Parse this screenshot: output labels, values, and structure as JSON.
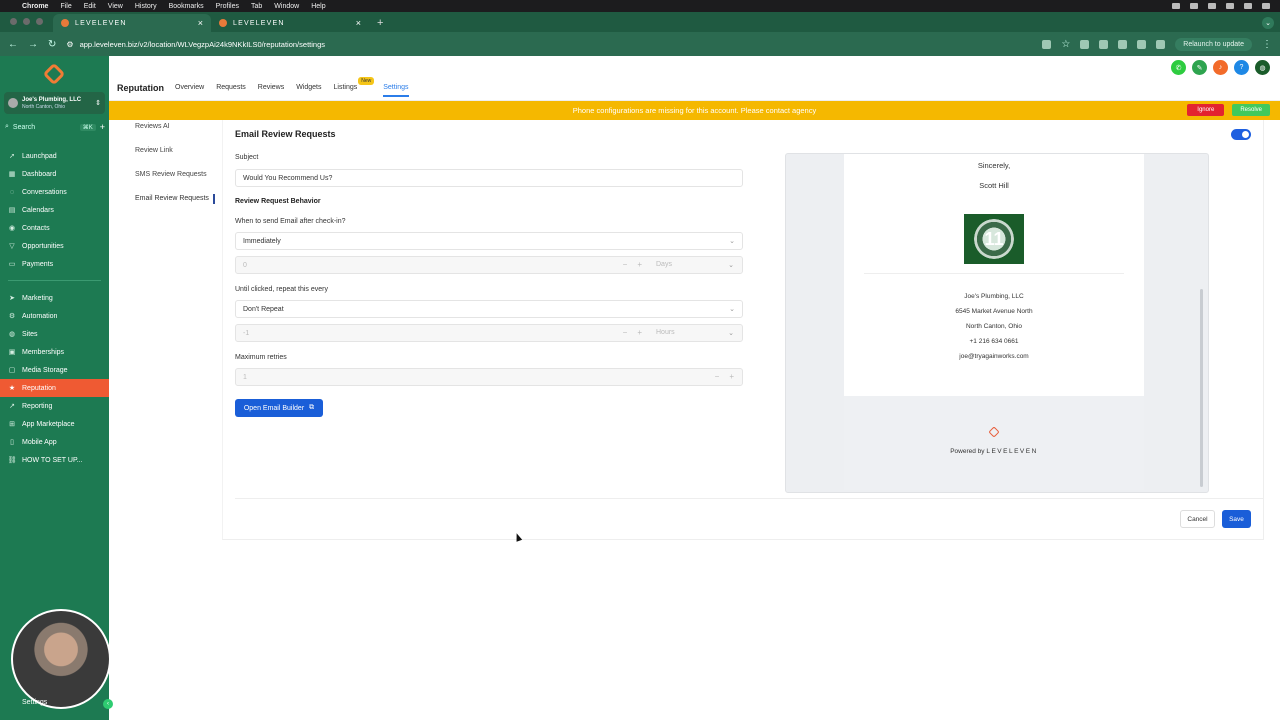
{
  "menubar": {
    "app": "Chrome",
    "items": [
      "File",
      "Edit",
      "View",
      "History",
      "Bookmarks",
      "Profiles",
      "Tab",
      "Window",
      "Help"
    ]
  },
  "browser": {
    "tabs": [
      {
        "label": "LEVELEVEN",
        "active": true
      },
      {
        "label": "LEVELEVEN",
        "active": false
      }
    ],
    "url": "app.leveleven.biz/v2/location/WLVegzpAi24k9NKkILS0/reputation/settings",
    "relaunch_label": "Relaunch to update"
  },
  "sidebar": {
    "account_name": "Joe's Plumbing, LLC",
    "account_location": "North Canton, Ohio",
    "search_placeholder": "Search",
    "search_shortcut": "⌘K",
    "group1": [
      {
        "label": "Launchpad",
        "icon": "rocket-icon"
      },
      {
        "label": "Dashboard",
        "icon": "dashboard-icon"
      },
      {
        "label": "Conversations",
        "icon": "chat-icon"
      },
      {
        "label": "Calendars",
        "icon": "calendar-icon"
      },
      {
        "label": "Contacts",
        "icon": "contacts-icon"
      },
      {
        "label": "Opportunities",
        "icon": "funnel-icon"
      },
      {
        "label": "Payments",
        "icon": "payments-icon"
      }
    ],
    "group2": [
      {
        "label": "Marketing",
        "icon": "send-icon"
      },
      {
        "label": "Automation",
        "icon": "automation-icon"
      },
      {
        "label": "Sites",
        "icon": "globe-icon"
      },
      {
        "label": "Memberships",
        "icon": "membership-icon"
      },
      {
        "label": "Media Storage",
        "icon": "media-icon"
      },
      {
        "label": "Reputation",
        "icon": "star-icon",
        "active": true
      },
      {
        "label": "Reporting",
        "icon": "chart-icon"
      },
      {
        "label": "App Marketplace",
        "icon": "grid-icon"
      },
      {
        "label": "Mobile App",
        "icon": "phone-icon"
      },
      {
        "label": "HOW TO SET UP...",
        "icon": "link-icon"
      }
    ],
    "settings_label": "Settings"
  },
  "header": {
    "title": "Reputation",
    "tabs": [
      "Overview",
      "Requests",
      "Reviews",
      "Widgets",
      "Listings",
      "Settings"
    ],
    "new_badge": "New",
    "active_tab": "Settings"
  },
  "warning": {
    "message": "Phone configurations are missing for this account. Please contact agency",
    "ignore_label": "Ignore",
    "resolve_label": "Resolve"
  },
  "subnav": {
    "items": [
      "Reviews AI",
      "Review Link",
      "SMS Review Requests",
      "Email Review Requests"
    ],
    "active": "Email Review Requests"
  },
  "form": {
    "title": "Email Review Requests",
    "enabled": true,
    "subject_label": "Subject",
    "subject_value": "Would You Recommend Us?",
    "behavior_label": "Review Request Behavior",
    "when_label": "When to send Email after check-in?",
    "when_value": "Immediately",
    "delay_value": "0",
    "delay_unit": "Days",
    "repeat_label": "Until clicked, repeat this every",
    "repeat_value": "Don't Repeat",
    "repeat_count": "-1",
    "repeat_unit": "Hours",
    "retries_label": "Maximum retries",
    "retries_value": "1",
    "builder_button": "Open Email Builder",
    "cancel_label": "Cancel",
    "save_label": "Save"
  },
  "preview": {
    "sincerely": "Sincerely,",
    "signer": "Scott Hill",
    "logo_text": "11",
    "business": "Joe's Plumbing, LLC",
    "street": "6545 Market Avenue North",
    "city": "North Canton, Ohio",
    "phone": "+1 216 634 0661",
    "email": "joe@tryagainworks.com",
    "powered_by": "Powered by",
    "brand": "LEVELEVEN"
  },
  "colors": {
    "sidebar": "#1d7a52",
    "active_nav": "#ef5a33",
    "primary": "#1a5ed8",
    "warning": "#f5b800"
  }
}
